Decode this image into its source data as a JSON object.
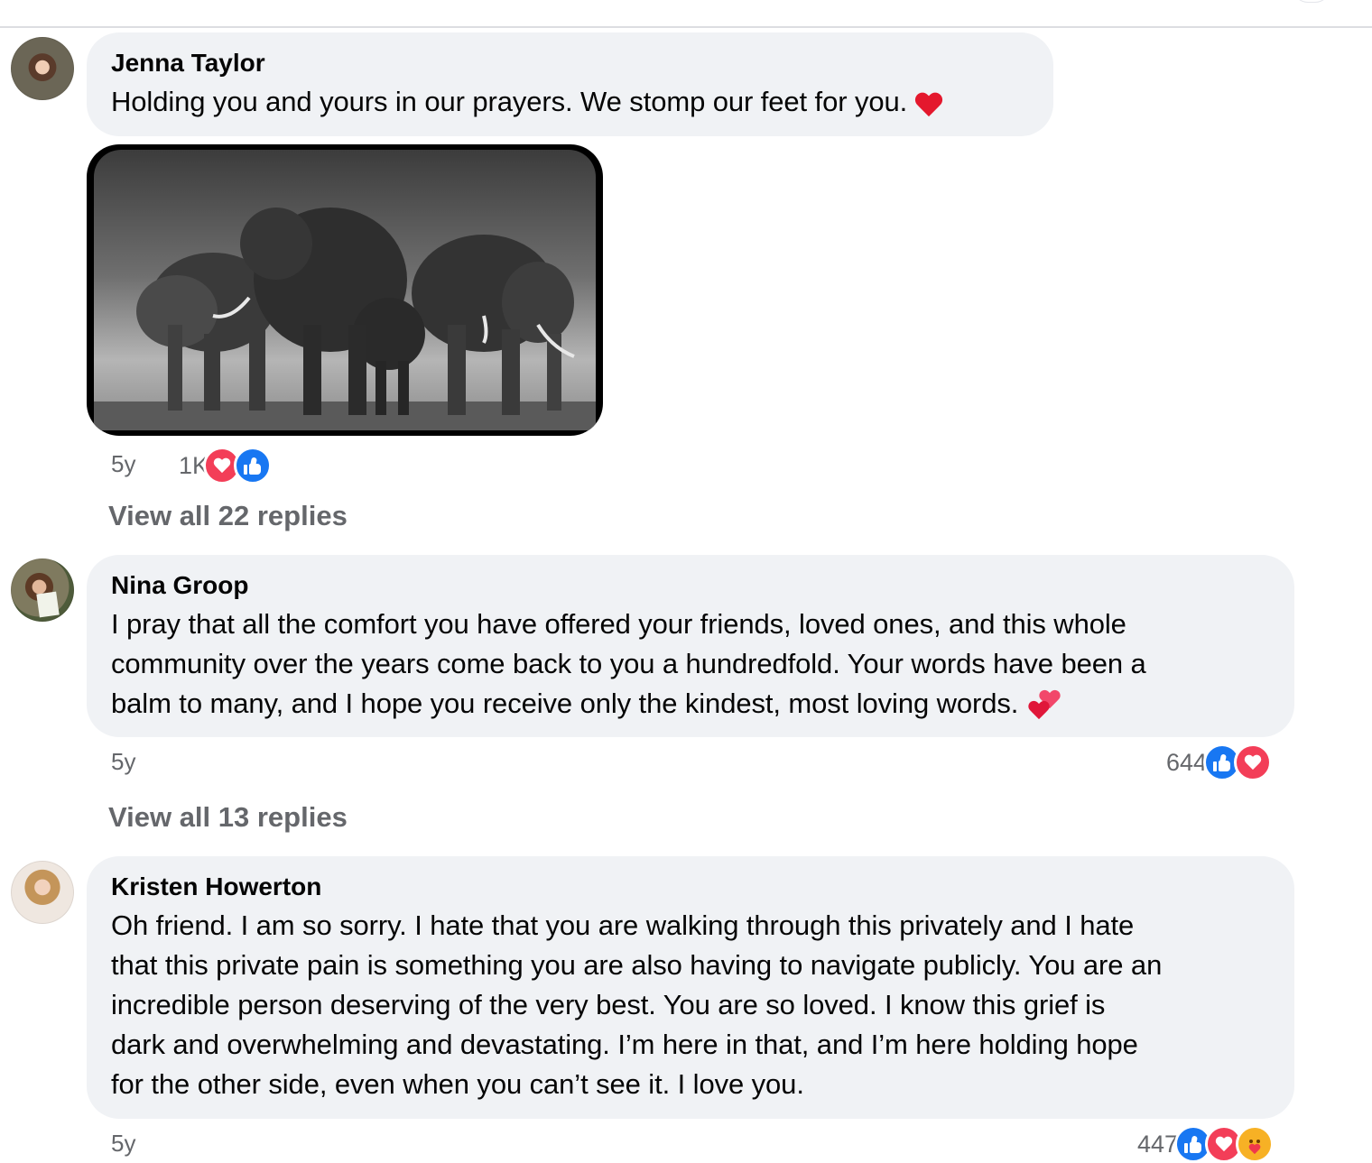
{
  "comments": [
    {
      "author": "Jenna Taylor",
      "text": "Holding you and yours in our prayers. We stomp our feet for you.",
      "emoji": "heart",
      "attachment": "elephant-herd-photo",
      "time": "5y",
      "reaction_count": "1K",
      "reactions": [
        "love",
        "like"
      ],
      "view_replies": "View all 22 replies"
    },
    {
      "author": "Nina Groop",
      "text_lines": [
        "I pray that all the comfort you have offered your friends, loved ones, and this whole",
        "community over the years come back to you a hundredfold. Your words have been a",
        "balm to many, and I hope you receive only the kindest, most loving words."
      ],
      "emoji": "two-hearts",
      "time": "5y",
      "reaction_count": "644",
      "reactions": [
        "like",
        "love"
      ],
      "view_replies": "View all 13 replies"
    },
    {
      "author": "Kristen Howerton",
      "text_lines": [
        "Oh friend. I am so sorry. I hate that you are walking through this privately and I hate",
        "that this private pain is something you are also having to navigate publicly. You are an",
        "incredible person deserving of the very best. You are so loved. I know this grief is",
        "dark and overwhelming and devastating. I’m here in that, and I’m here holding hope",
        "for the other side, even when you can’t see it. I love you."
      ],
      "time": "5y",
      "reaction_count": "447",
      "reactions": [
        "like",
        "love",
        "care"
      ]
    }
  ],
  "colors": {
    "bubble": "#f0f2f5",
    "secondary_text": "#65676b",
    "like": "#1877f2",
    "love": "#f33e58",
    "care": "#f7b125"
  }
}
